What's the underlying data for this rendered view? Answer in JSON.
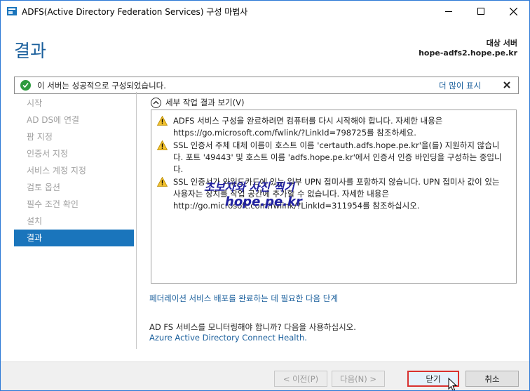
{
  "window": {
    "title": "ADFS(Active Directory Federation Services) 구성 마법사"
  },
  "header": {
    "page_title": "결과",
    "target_label": "대상 서버",
    "target_server": "hope-adfs2.hope.pe.kr"
  },
  "notification": {
    "text": "이 서버는 성공적으로 구성되었습니다.",
    "more_link": "더 많이 표시",
    "status_color": "#2e9b3e"
  },
  "nav": {
    "items": [
      {
        "label": "시작"
      },
      {
        "label": "AD DS에 연결"
      },
      {
        "label": "팜 지정"
      },
      {
        "label": "인증서 지정"
      },
      {
        "label": "서비스 계정 지정"
      },
      {
        "label": "검토 옵션"
      },
      {
        "label": "필수 조건 확인"
      },
      {
        "label": "설치"
      },
      {
        "label": "결과"
      }
    ],
    "active_index": 8
  },
  "details": {
    "toggle_label": "세부 작업 결과 보기(V)",
    "messages": [
      {
        "icon": "warning-icon",
        "text": "ADFS 서비스 구성을 완료하려면 컴퓨터를 다시 시작해야 합니다. 자세한 내용은 https://go.microsoft.com/fwlink/?LinkId=798725를 참조하세요."
      },
      {
        "icon": "warning-icon",
        "text": "SSL 인증서 주체 대체 이름이 호스트 이름 'certauth.adfs.hope.pe.kr'을(를) 지원하지 않습니다. 포트 '49443' 및 호스트 이름 'adfs.hope.pe.kr'에서 인증서 인증 바인딩을 구성하는 중입니다."
      },
      {
        "icon": "warning-icon",
        "text": "SSL 인증서가 와일드카드에 있는 일부 UPN 접미사를 포함하지 않습니다. UPN 접미사 값이 있는 사용자는 장치를 작업 공간에 추가할 수 없습니다. 자세한 내용은 http://go.microsoft.com/fwlink/?LinkId=311954를 참조하십시오."
      }
    ]
  },
  "watermark": {
    "line1": "초보자와 사진 찍기",
    "line2": "hope.pe.kr"
  },
  "links": {
    "next_steps": "페더레이션 서비스 배포를 완료하는 데 필요한 다음 단계",
    "monitor_text": "AD FS 서비스를 모니터링해야 합니까? 다음을 사용하십시오.",
    "connect_health": "Azure Active Directory Connect Health."
  },
  "buttons": {
    "prev": "< 이전(P)",
    "next": "다음(N) >",
    "close": "닫기",
    "cancel": "취소"
  },
  "colors": {
    "title_blue": "#1a5f9c",
    "nav_active": "#1a75bc",
    "highlight_red": "#d9312f"
  }
}
